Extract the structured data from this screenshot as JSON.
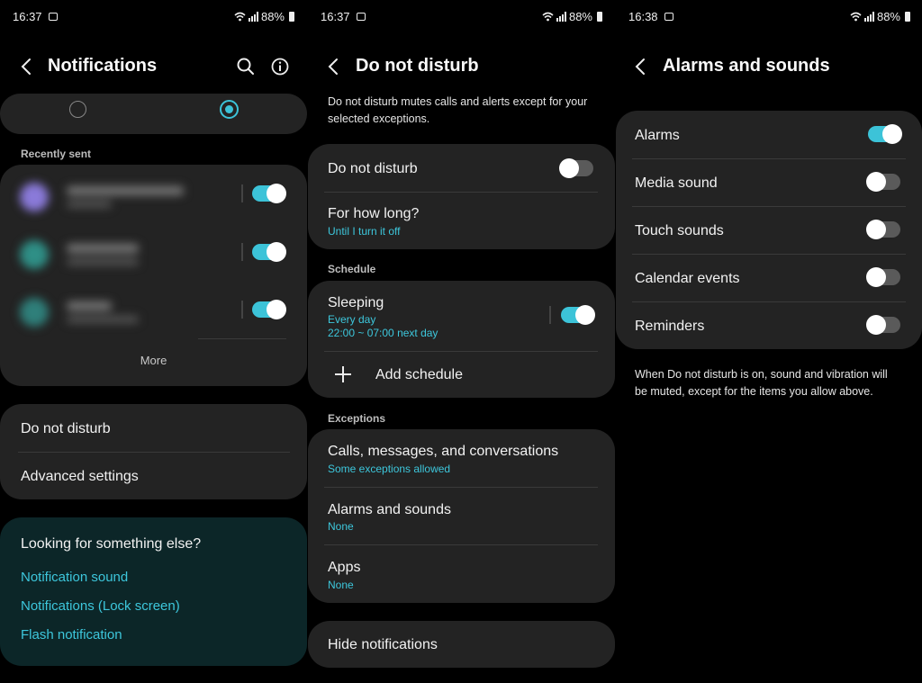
{
  "accent": "#3cc3d8",
  "panels": {
    "notifications": {
      "status": {
        "time": "16:37",
        "battery": "88%"
      },
      "title": "Notifications",
      "recently_sent_label": "Recently sent",
      "apps": [
        {
          "enabled": true
        },
        {
          "enabled": true
        },
        {
          "enabled": true
        }
      ],
      "more_label": "More",
      "menu": {
        "dnd": "Do not disturb",
        "advanced": "Advanced settings"
      },
      "suggest": {
        "title": "Looking for something else?",
        "links": [
          "Notification sound",
          "Notifications (Lock screen)",
          "Flash notification"
        ]
      }
    },
    "dnd": {
      "status": {
        "time": "16:37",
        "battery": "88%"
      },
      "title": "Do not disturb",
      "description": "Do not disturb mutes calls and alerts except for your selected exceptions.",
      "dnd_toggle_label": "Do not disturb",
      "dnd_enabled": false,
      "for_how_long": {
        "label": "For how long?",
        "value": "Until I turn it off"
      },
      "schedule_label": "Schedule",
      "sleeping": {
        "label": "Sleeping",
        "days": "Every day",
        "time": "22:00 ~ 07:00 next day",
        "enabled": true
      },
      "add_schedule": "Add schedule",
      "exceptions_label": "Exceptions",
      "exceptions": [
        {
          "label": "Calls, messages, and conversations",
          "value": "Some exceptions allowed"
        },
        {
          "label": "Alarms and sounds",
          "value": "None"
        },
        {
          "label": "Apps",
          "value": "None"
        }
      ],
      "hide_notifications": "Hide notifications"
    },
    "alarms": {
      "status": {
        "time": "16:38",
        "battery": "88%"
      },
      "title": "Alarms and sounds",
      "items": [
        {
          "label": "Alarms",
          "enabled": true
        },
        {
          "label": "Media sound",
          "enabled": false
        },
        {
          "label": "Touch sounds",
          "enabled": false
        },
        {
          "label": "Calendar events",
          "enabled": false
        },
        {
          "label": "Reminders",
          "enabled": false
        }
      ],
      "note": "When Do not disturb is on, sound and vibration will be muted, except for the items you allow above."
    }
  }
}
